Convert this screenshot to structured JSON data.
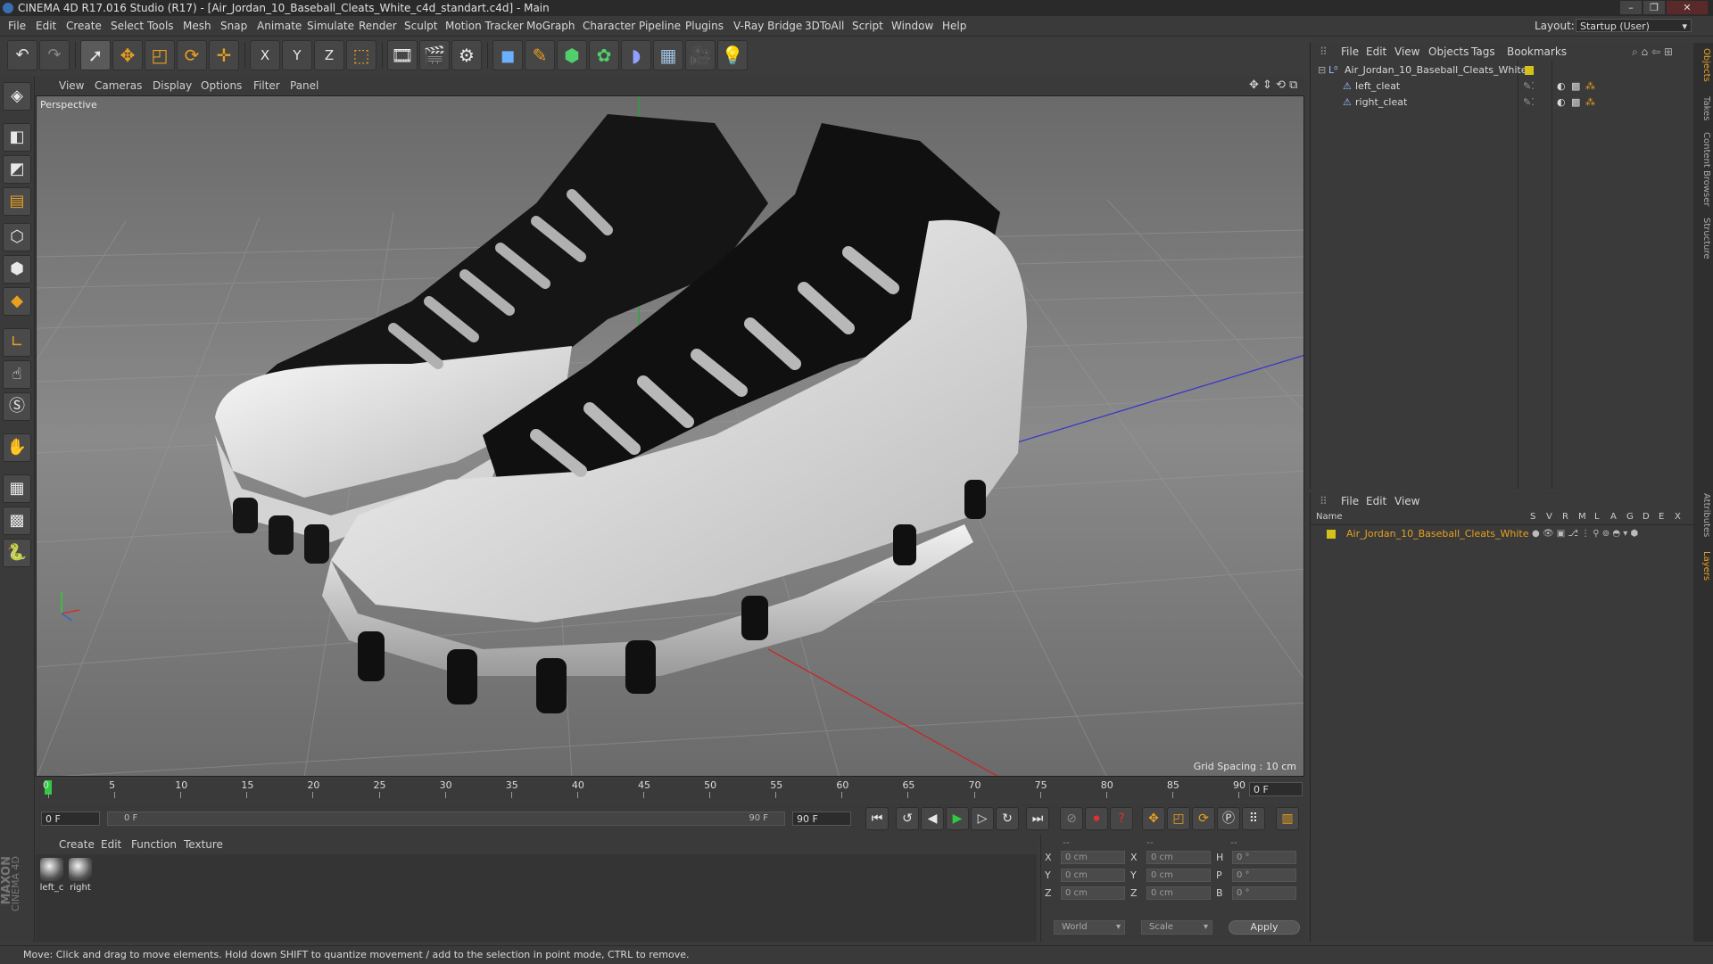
{
  "titlebar": {
    "title": "CINEMA 4D R17.016 Studio (R17) - [Air_Jordan_10_Baseball_Cleats_White_c4d_standart.c4d] - Main"
  },
  "menubar": {
    "items": [
      "File",
      "Edit",
      "Create",
      "Select",
      "Tools",
      "Mesh",
      "Snap",
      "Animate",
      "Simulate",
      "Render",
      "Sculpt",
      "Motion Tracker",
      "MoGraph",
      "Character",
      "Pipeline",
      "Plugins",
      "V-Ray Bridge",
      "3DToAll",
      "Script",
      "Window",
      "Help"
    ],
    "layout_label": "Layout:",
    "layout_value": "Startup (User)"
  },
  "toolbar": {
    "axis_x": "X",
    "axis_y": "Y",
    "axis_z": "Z"
  },
  "viewport": {
    "menu": [
      "View",
      "Cameras",
      "Display",
      "Options",
      "Filter",
      "Panel"
    ],
    "label": "Perspective",
    "grid_spacing": "Grid Spacing : 10 cm"
  },
  "timeline": {
    "ticks": [
      "0",
      "5",
      "10",
      "15",
      "20",
      "25",
      "30",
      "35",
      "40",
      "45",
      "50",
      "55",
      "60",
      "65",
      "70",
      "75",
      "80",
      "85",
      "90"
    ],
    "current_frame": "0 F",
    "start_frame": "0 F",
    "range_start": "0 F",
    "range_end": "90 F",
    "end_frame": "90 F",
    "right_frame": "0 F"
  },
  "material_manager": {
    "menu": [
      "Create",
      "Edit",
      "Function",
      "Texture"
    ],
    "materials": [
      {
        "label": "left_c"
      },
      {
        "label": "right"
      }
    ]
  },
  "coordinates": {
    "header": [
      "--",
      "--",
      "--"
    ],
    "rows": [
      {
        "l1": "X",
        "v1": "0 cm",
        "l2": "X",
        "v2": "0 cm",
        "l3": "H",
        "v3": "0 °"
      },
      {
        "l1": "Y",
        "v1": "0 cm",
        "l2": "Y",
        "v2": "0 cm",
        "l3": "P",
        "v3": "0 °"
      },
      {
        "l1": "Z",
        "v1": "0 cm",
        "l2": "Z",
        "v2": "0 cm",
        "l3": "B",
        "v3": "0 °"
      }
    ],
    "world": "World",
    "scale": "Scale",
    "apply": "Apply"
  },
  "object_manager": {
    "menu": [
      "File",
      "Edit",
      "View",
      "Objects",
      "Tags",
      "Bookmarks"
    ],
    "objects": [
      {
        "name": "Air_Jordan_10_Baseball_Cleats_White"
      },
      {
        "name": "left_cleat"
      },
      {
        "name": "right_cleat"
      }
    ]
  },
  "layer_manager": {
    "menu": [
      "File",
      "Edit",
      "View"
    ],
    "name_header": "Name",
    "columns": [
      "S",
      "V",
      "R",
      "M",
      "L",
      "A",
      "G",
      "D",
      "E",
      "X"
    ],
    "layers": [
      {
        "name": "Air_Jordan_10_Baseball_Cleats_White",
        "color": "#d4c21a"
      }
    ]
  },
  "side_tabs": [
    "Objects",
    "Takes",
    "Content Browser",
    "Structure",
    "Attributes",
    "Layers"
  ],
  "brand": {
    "maxon": "MAXON",
    "cinema": "CINEMA 4D"
  },
  "statusbar": {
    "text": "Move: Click and drag to move elements. Hold down SHIFT to quantize movement / add to the selection in point mode, CTRL to remove."
  },
  "colors": {
    "accent_orange": "#e8a020",
    "timeline_marker": "#2ecc40",
    "layer_yellow": "#d4c21a"
  }
}
